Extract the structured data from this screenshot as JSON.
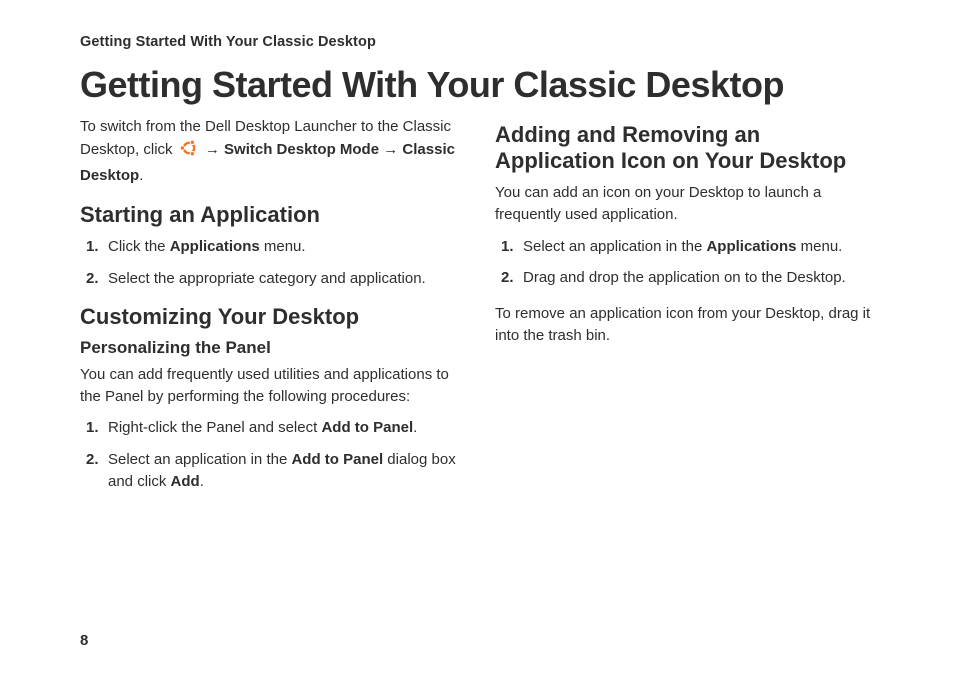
{
  "runningHeader": "Getting Started With Your Classic Desktop",
  "pageTitle": "Getting Started With Your Classic Desktop",
  "left": {
    "intro": {
      "pre": "To switch from the Dell Desktop Launcher to the Classic Desktop, click ",
      "arrow1": "→ ",
      "b1": "Switch Desktop Mode",
      "arrow2": "→ ",
      "b2": "Classic Desktop",
      "period": "."
    },
    "section1": {
      "title": "Starting an Application",
      "steps": [
        {
          "pre": "Click the ",
          "b": "Applications",
          "post": " menu."
        },
        {
          "plain": "Select the appropriate category and application."
        }
      ]
    },
    "section2": {
      "title": "Customizing Your Desktop",
      "sub": "Personalizing the Panel",
      "body": "You can add frequently used utilities and applications to the Panel by performing the following procedures:",
      "steps": [
        {
          "pre": "Right-click the Panel and select ",
          "b": "Add to Panel",
          "post": "."
        },
        {
          "pre": "Select an application in the ",
          "b": "Add to Panel",
          "mid": " dialog box and click ",
          "b2": "Add",
          "post": "."
        }
      ]
    }
  },
  "right": {
    "section": {
      "title": "Adding and Removing an Application Icon on Your Desktop",
      "body": "You can add an icon on your Desktop to launch a frequently used application.",
      "steps": [
        {
          "pre": "Select an application in the ",
          "b": "Applications",
          "post": " menu."
        },
        {
          "plain": "Drag and drop the application on to the Desktop."
        }
      ],
      "tail": "To remove an application icon from your Desktop, drag it into the trash bin."
    }
  },
  "pageNumber": "8"
}
